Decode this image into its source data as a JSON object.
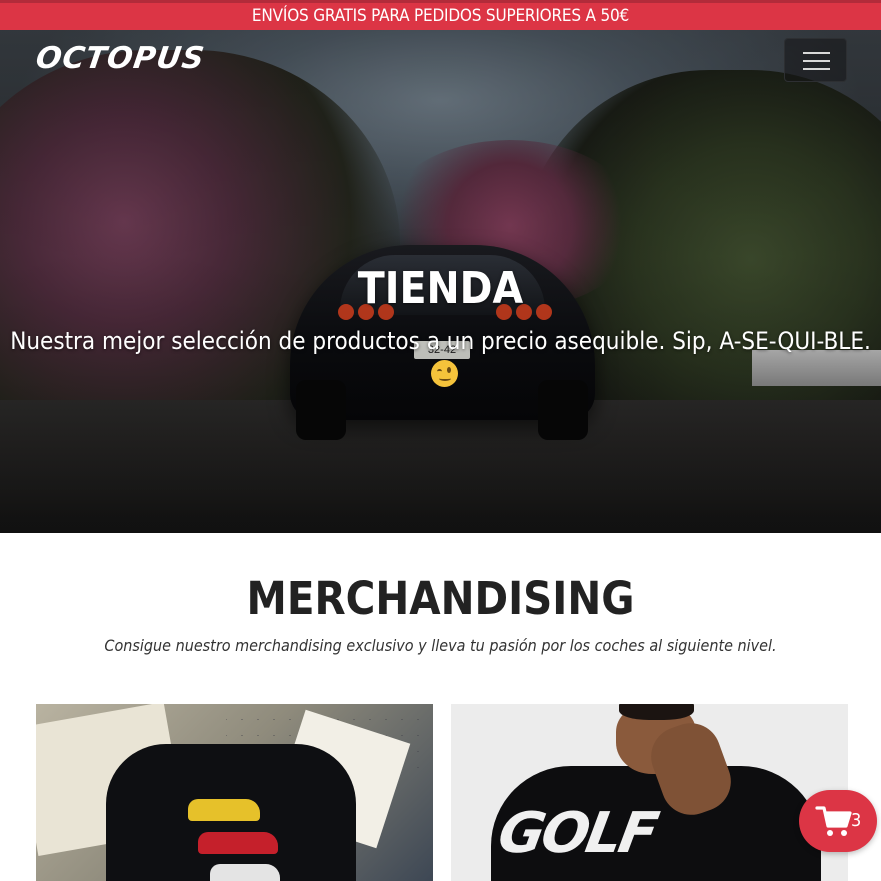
{
  "promo": {
    "text": "ENVÍOS GRATIS PARA PEDIDOS SUPERIORES A 50€"
  },
  "header": {
    "logo": "OCTOPUS",
    "menu_icon": "hamburger-menu-icon"
  },
  "hero": {
    "title": "TIENDA",
    "subtitle": "Nuestra mejor selección de productos a un precio asequible. Sip, A-SE-QUI-BLE.",
    "emoji_icon": "winking-face-icon",
    "plate": "32-42"
  },
  "merch": {
    "title": "MERCHANDISING",
    "subtitle": "Consigue nuestro merchandising exclusivo y lleva tu pasión por los coches al siguiente nivel.",
    "products": [
      {
        "image_icon": "black-hoodie-car-print-image"
      },
      {
        "image_icon": "black-tshirt-model-image",
        "print_text": "GOLF"
      }
    ]
  },
  "cart": {
    "icon": "shopping-cart-icon",
    "count": "3"
  },
  "colors": {
    "accent": "#dc3545",
    "text_dark": "#222222",
    "white": "#ffffff"
  }
}
